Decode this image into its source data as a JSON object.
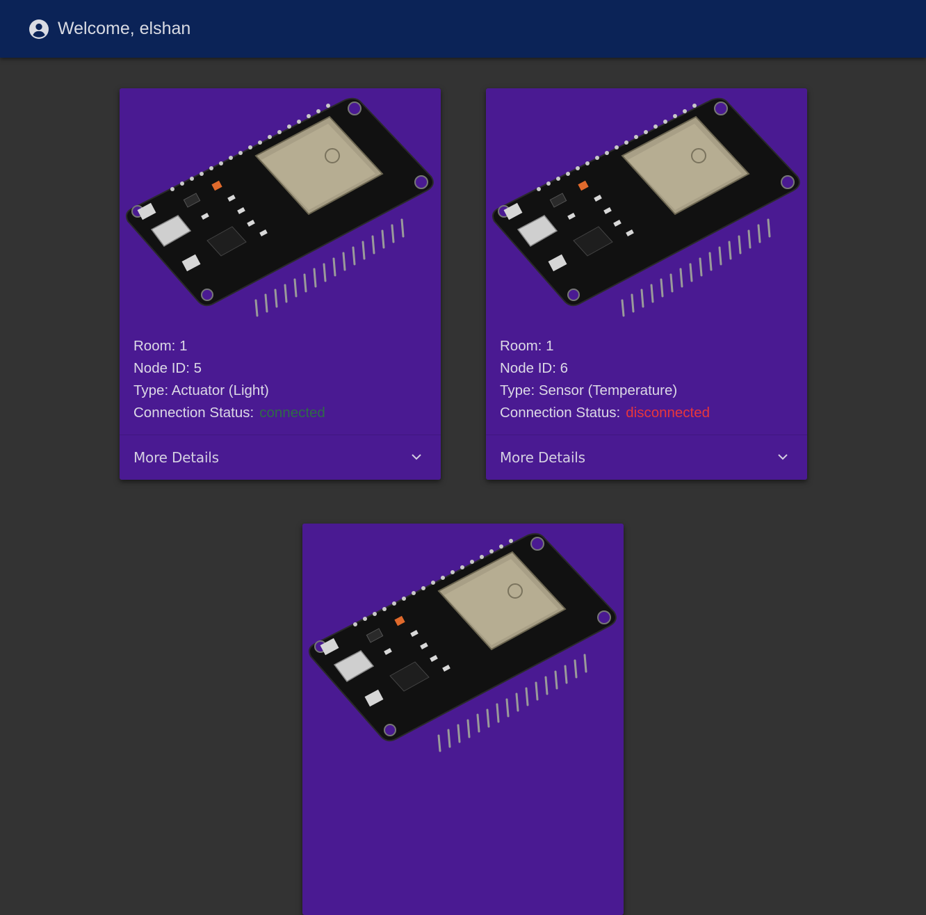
{
  "header": {
    "welcome_text": "Welcome, elshan"
  },
  "colors": {
    "header_bg": "#0b2357",
    "page_bg": "#333333",
    "card_bg": "#4a1a92",
    "connected": "#2f6b47",
    "disconnected": "#e8363c"
  },
  "cards": [
    {
      "image": "esp32-board",
      "room": "Room: 1",
      "node_id": "Node ID: 5",
      "type": "Type: Actuator (Light)",
      "status_label": "Connection Status:",
      "status_value": "connected",
      "more_label": "More Details"
    },
    {
      "image": "esp32-board",
      "room": "Room: 1",
      "node_id": "Node ID: 6",
      "type": "Type: Sensor (Temperature)",
      "status_label": "Connection Status:",
      "status_value": "disconnected",
      "more_label": "More Details"
    },
    {
      "image": "esp32-board"
    }
  ]
}
